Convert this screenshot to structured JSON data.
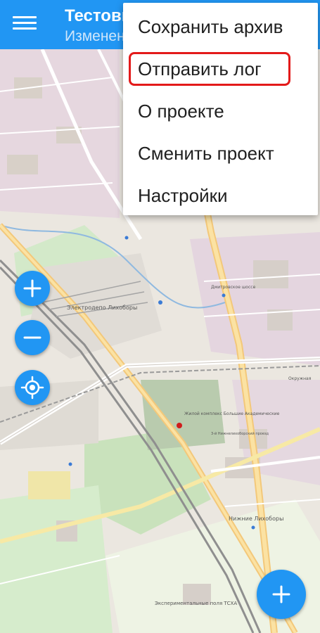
{
  "app_bar": {
    "title": "Тестовый проект",
    "subtitle": "Изменения не сохранены",
    "menu_icon": "hamburger-menu-icon"
  },
  "overflow_menu": {
    "items": [
      {
        "label": "Сохранить архив"
      },
      {
        "label": "Отправить лог"
      },
      {
        "label": "О проекте"
      },
      {
        "label": "Сменить проект"
      },
      {
        "label": "Настройки"
      }
    ],
    "highlighted_item": "Отправить лог",
    "highlight_color": "#e31a1a"
  },
  "map": {
    "labels": [
      "Электродепо Лихоборы",
      "Нижние Лихоборы",
      "Экспериментальные поля ТСХА",
      "Дмитровское шоссе",
      "Окружная",
      "Жилой комплекс Большие Академические",
      "3-й Нижнелихоборский проезд"
    ],
    "accent_color": "#2196f3"
  },
  "map_controls": {
    "zoom_in_icon": "plus-icon",
    "zoom_out_icon": "minus-icon",
    "locate_icon": "crosshair-location-icon",
    "add_icon": "plus-icon"
  }
}
